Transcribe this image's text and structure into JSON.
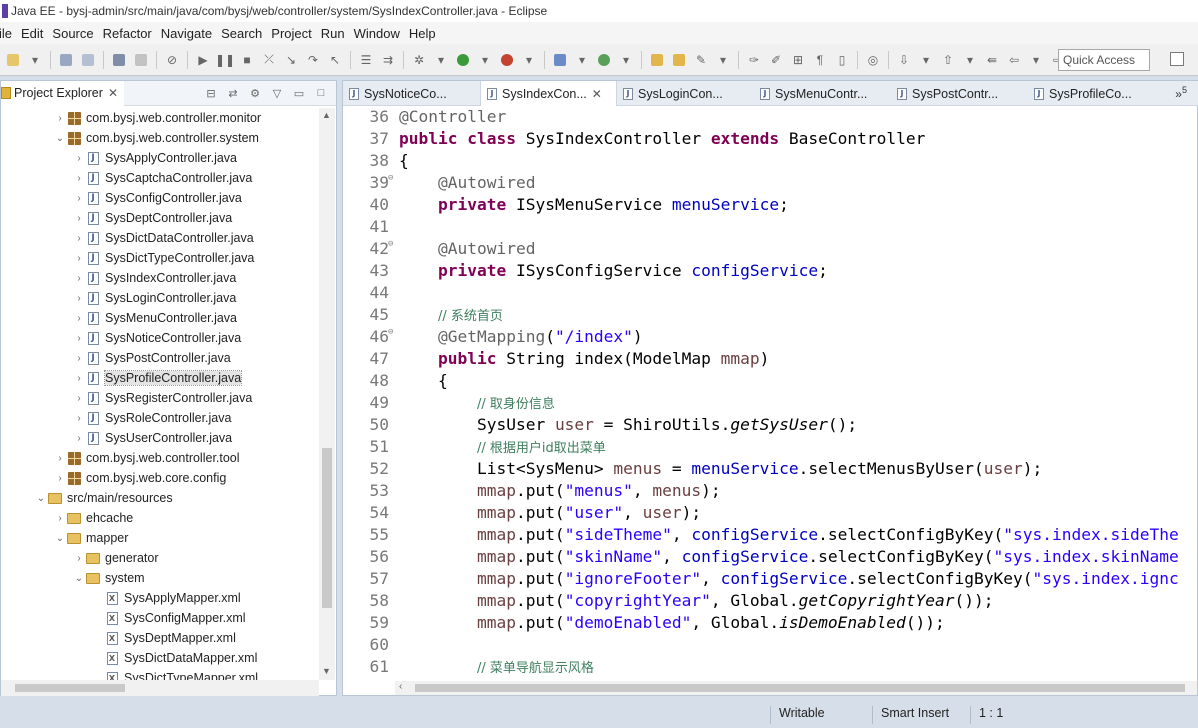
{
  "window": {
    "title": "Java EE - bysj-admin/src/main/java/com/bysj/web/controller/system/SysIndexController.java - Eclipse"
  },
  "menu": [
    "ile",
    "Edit",
    "Source",
    "Refactor",
    "Navigate",
    "Search",
    "Project",
    "Run",
    "Window",
    "Help"
  ],
  "toolbar": {
    "quick_access": "Quick Access"
  },
  "explorer": {
    "title": "Project Explorer",
    "rows": [
      {
        "label": "com.bysj.web.controller.monitor",
        "indent": 1,
        "arrow": "›",
        "icon": "package"
      },
      {
        "label": "com.bysj.web.controller.system",
        "indent": 1,
        "arrow": "⌄",
        "icon": "package"
      },
      {
        "label": "SysApplyController.java",
        "indent": 2,
        "arrow": "›",
        "icon": "java"
      },
      {
        "label": "SysCaptchaController.java",
        "indent": 2,
        "arrow": "›",
        "icon": "java"
      },
      {
        "label": "SysConfigController.java",
        "indent": 2,
        "arrow": "›",
        "icon": "java"
      },
      {
        "label": "SysDeptController.java",
        "indent": 2,
        "arrow": "›",
        "icon": "java"
      },
      {
        "label": "SysDictDataController.java",
        "indent": 2,
        "arrow": "›",
        "icon": "java"
      },
      {
        "label": "SysDictTypeController.java",
        "indent": 2,
        "arrow": "›",
        "icon": "java"
      },
      {
        "label": "SysIndexController.java",
        "indent": 2,
        "arrow": "›",
        "icon": "java"
      },
      {
        "label": "SysLoginController.java",
        "indent": 2,
        "arrow": "›",
        "icon": "java"
      },
      {
        "label": "SysMenuController.java",
        "indent": 2,
        "arrow": "›",
        "icon": "java"
      },
      {
        "label": "SysNoticeController.java",
        "indent": 2,
        "arrow": "›",
        "icon": "java"
      },
      {
        "label": "SysPostController.java",
        "indent": 2,
        "arrow": "›",
        "icon": "java"
      },
      {
        "label": "SysProfileController.java",
        "indent": 2,
        "arrow": "›",
        "icon": "java",
        "selected": true
      },
      {
        "label": "SysRegisterController.java",
        "indent": 2,
        "arrow": "›",
        "icon": "java"
      },
      {
        "label": "SysRoleController.java",
        "indent": 2,
        "arrow": "›",
        "icon": "java"
      },
      {
        "label": "SysUserController.java",
        "indent": 2,
        "arrow": "›",
        "icon": "java"
      },
      {
        "label": "com.bysj.web.controller.tool",
        "indent": 1,
        "arrow": "›",
        "icon": "package"
      },
      {
        "label": "com.bysj.web.core.config",
        "indent": 1,
        "arrow": "›",
        "icon": "package"
      },
      {
        "label": "src/main/resources",
        "indent": 0,
        "arrow": "⌄",
        "icon": "folder"
      },
      {
        "label": "ehcache",
        "indent": 1,
        "arrow": "›",
        "icon": "folder"
      },
      {
        "label": "mapper",
        "indent": 1,
        "arrow": "⌄",
        "icon": "folder"
      },
      {
        "label": "generator",
        "indent": 2,
        "arrow": "›",
        "icon": "folder"
      },
      {
        "label": "system",
        "indent": 2,
        "arrow": "⌄",
        "icon": "folder"
      },
      {
        "label": "SysApplyMapper.xml",
        "indent": 3,
        "arrow": "",
        "icon": "xml"
      },
      {
        "label": "SysConfigMapper.xml",
        "indent": 3,
        "arrow": "",
        "icon": "xml"
      },
      {
        "label": "SysDeptMapper.xml",
        "indent": 3,
        "arrow": "",
        "icon": "xml"
      },
      {
        "label": "SysDictDataMapper.xml",
        "indent": 3,
        "arrow": "",
        "icon": "xml"
      },
      {
        "label": "SysDictTypeMapper.xml",
        "indent": 3,
        "arrow": "",
        "icon": "xml"
      }
    ]
  },
  "editor": {
    "tabs": [
      {
        "label": "SysNoticeCo...",
        "active": false
      },
      {
        "label": "SysIndexCon...",
        "active": true
      },
      {
        "label": "SysLoginCon...",
        "active": false
      },
      {
        "label": "SysMenuContr...",
        "active": false
      },
      {
        "label": "SysPostContr...",
        "active": false
      },
      {
        "label": "SysProfileCo...",
        "active": false
      }
    ],
    "more_tabs": "»",
    "more_count": "5",
    "lines": [
      {
        "n": "36",
        "fold": false,
        "tokens": [
          [
            "ann",
            "@Controller"
          ]
        ]
      },
      {
        "n": "37",
        "fold": false,
        "tokens": [
          [
            "kw",
            "public"
          ],
          [
            "",
            " "
          ],
          [
            "kw",
            "class"
          ],
          [
            "",
            " SysIndexController "
          ],
          [
            "kw",
            "extends"
          ],
          [
            "",
            " BaseController"
          ]
        ]
      },
      {
        "n": "38",
        "fold": false,
        "tokens": [
          [
            "",
            "{"
          ]
        ]
      },
      {
        "n": "39",
        "fold": true,
        "tokens": [
          [
            "",
            "    "
          ],
          [
            "ann",
            "@Autowired"
          ]
        ]
      },
      {
        "n": "40",
        "fold": false,
        "tokens": [
          [
            "",
            "    "
          ],
          [
            "kw",
            "private"
          ],
          [
            "",
            " ISysMenuService "
          ],
          [
            "fld",
            "menuService"
          ],
          [
            "",
            ";"
          ]
        ]
      },
      {
        "n": "41",
        "fold": false,
        "tokens": [
          [
            "",
            ""
          ]
        ]
      },
      {
        "n": "42",
        "fold": true,
        "tokens": [
          [
            "",
            "    "
          ],
          [
            "ann",
            "@Autowired"
          ]
        ]
      },
      {
        "n": "43",
        "fold": false,
        "tokens": [
          [
            "",
            "    "
          ],
          [
            "kw",
            "private"
          ],
          [
            "",
            " ISysConfigService "
          ],
          [
            "fld",
            "configService"
          ],
          [
            "",
            ";"
          ]
        ]
      },
      {
        "n": "44",
        "fold": false,
        "tokens": [
          [
            "",
            ""
          ]
        ]
      },
      {
        "n": "45",
        "fold": false,
        "tokens": [
          [
            "",
            "    "
          ],
          [
            "cmt",
            "// 系统首页"
          ]
        ]
      },
      {
        "n": "46",
        "fold": true,
        "tokens": [
          [
            "",
            "    "
          ],
          [
            "ann",
            "@GetMapping"
          ],
          [
            "",
            "("
          ],
          [
            "str",
            "\"/index\""
          ],
          [
            "",
            ")"
          ]
        ]
      },
      {
        "n": "47",
        "fold": false,
        "tokens": [
          [
            "",
            "    "
          ],
          [
            "kw",
            "public"
          ],
          [
            "",
            " String index(ModelMap "
          ],
          [
            "var",
            "mmap"
          ],
          [
            "",
            ")"
          ]
        ]
      },
      {
        "n": "48",
        "fold": false,
        "tokens": [
          [
            "",
            "    {"
          ]
        ]
      },
      {
        "n": "49",
        "fold": false,
        "tokens": [
          [
            "",
            "        "
          ],
          [
            "cmt",
            "// 取身份信息"
          ]
        ]
      },
      {
        "n": "50",
        "fold": false,
        "tokens": [
          [
            "",
            "        SysUser "
          ],
          [
            "var",
            "user"
          ],
          [
            "",
            " = ShiroUtils."
          ],
          [
            "sm",
            "getSysUser"
          ],
          [
            "",
            "();"
          ]
        ]
      },
      {
        "n": "51",
        "fold": false,
        "tokens": [
          [
            "",
            "        "
          ],
          [
            "cmt",
            "// 根据用户id取出菜单"
          ]
        ]
      },
      {
        "n": "52",
        "fold": false,
        "tokens": [
          [
            "",
            "        List<SysMenu> "
          ],
          [
            "var",
            "menus"
          ],
          [
            "",
            " = "
          ],
          [
            "fld",
            "menuService"
          ],
          [
            "",
            ".selectMenusByUser("
          ],
          [
            "var",
            "user"
          ],
          [
            "",
            ");"
          ]
        ]
      },
      {
        "n": "53",
        "fold": false,
        "tokens": [
          [
            "",
            "        "
          ],
          [
            "var",
            "mmap"
          ],
          [
            "",
            ".put("
          ],
          [
            "str",
            "\"menus\""
          ],
          [
            "",
            ", "
          ],
          [
            "var",
            "menus"
          ],
          [
            "",
            ");"
          ]
        ]
      },
      {
        "n": "54",
        "fold": false,
        "tokens": [
          [
            "",
            "        "
          ],
          [
            "var",
            "mmap"
          ],
          [
            "",
            ".put("
          ],
          [
            "str",
            "\"user\""
          ],
          [
            "",
            ", "
          ],
          [
            "var",
            "user"
          ],
          [
            "",
            ");"
          ]
        ]
      },
      {
        "n": "55",
        "fold": false,
        "tokens": [
          [
            "",
            "        "
          ],
          [
            "var",
            "mmap"
          ],
          [
            "",
            ".put("
          ],
          [
            "str",
            "\"sideTheme\""
          ],
          [
            "",
            ", "
          ],
          [
            "fld",
            "configService"
          ],
          [
            "",
            ".selectConfigByKey("
          ],
          [
            "str",
            "\"sys.index.sideThe"
          ]
        ]
      },
      {
        "n": "56",
        "fold": false,
        "tokens": [
          [
            "",
            "        "
          ],
          [
            "var",
            "mmap"
          ],
          [
            "",
            ".put("
          ],
          [
            "str",
            "\"skinName\""
          ],
          [
            "",
            ", "
          ],
          [
            "fld",
            "configService"
          ],
          [
            "",
            ".selectConfigByKey("
          ],
          [
            "str",
            "\"sys.index.skinName"
          ]
        ]
      },
      {
        "n": "57",
        "fold": false,
        "tokens": [
          [
            "",
            "        "
          ],
          [
            "var",
            "mmap"
          ],
          [
            "",
            ".put("
          ],
          [
            "str",
            "\"ignoreFooter\""
          ],
          [
            "",
            ", "
          ],
          [
            "fld",
            "configService"
          ],
          [
            "",
            ".selectConfigByKey("
          ],
          [
            "str",
            "\"sys.index.ignc"
          ]
        ]
      },
      {
        "n": "58",
        "fold": false,
        "tokens": [
          [
            "",
            "        "
          ],
          [
            "var",
            "mmap"
          ],
          [
            "",
            ".put("
          ],
          [
            "str",
            "\"copyrightYear\""
          ],
          [
            "",
            ", Global."
          ],
          [
            "sm",
            "getCopyrightYear"
          ],
          [
            "",
            "());"
          ]
        ]
      },
      {
        "n": "59",
        "fold": false,
        "tokens": [
          [
            "",
            "        "
          ],
          [
            "var",
            "mmap"
          ],
          [
            "",
            ".put("
          ],
          [
            "str",
            "\"demoEnabled\""
          ],
          [
            "",
            ", Global."
          ],
          [
            "sm",
            "isDemoEnabled"
          ],
          [
            "",
            "());"
          ]
        ]
      },
      {
        "n": "60",
        "fold": false,
        "tokens": [
          [
            "",
            ""
          ]
        ]
      },
      {
        "n": "61",
        "fold": false,
        "tokens": [
          [
            "",
            "        "
          ],
          [
            "cmt",
            "// 菜单导航显示风格"
          ]
        ]
      }
    ]
  },
  "status": {
    "writable": "Writable",
    "insert_mode": "Smart Insert",
    "position": "1 : 1"
  }
}
